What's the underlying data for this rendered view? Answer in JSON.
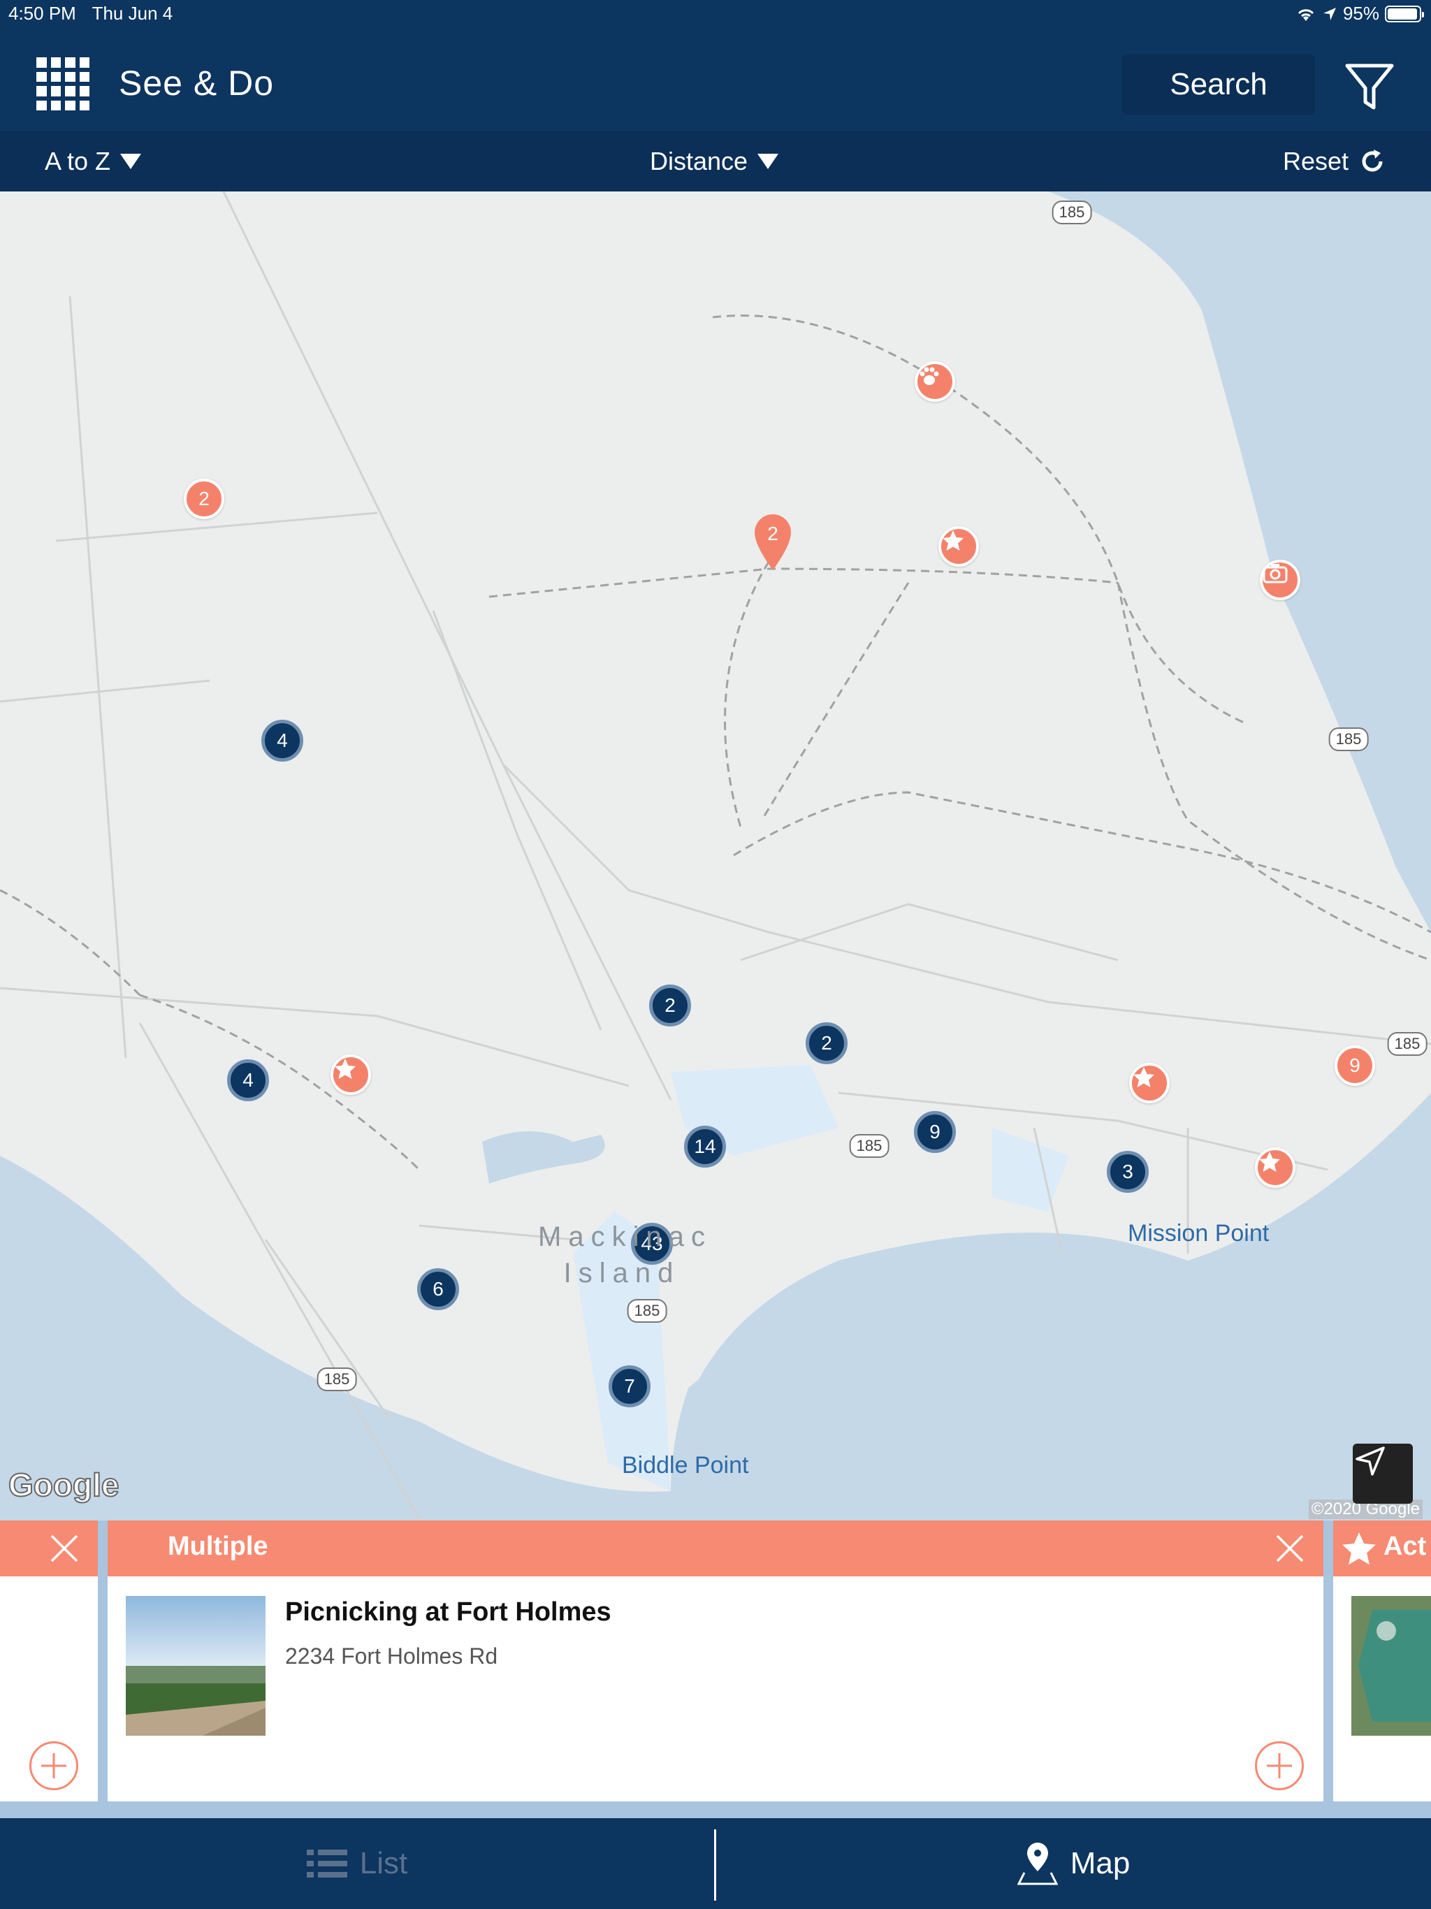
{
  "status_bar": {
    "time": "4:50 PM",
    "date": "Thu Jun 4",
    "battery_text": "95%",
    "battery_level": 0.95
  },
  "header": {
    "title": "See & Do",
    "search_label": "Search"
  },
  "sort_bar": {
    "sort_az": "A to Z",
    "sort_distance": "Distance",
    "reset": "Reset"
  },
  "map": {
    "clusters_navy": [
      "4",
      "4",
      "2",
      "2",
      "14",
      "9",
      "3",
      "43",
      "6",
      "7"
    ],
    "pins_orange": [
      "2",
      "2",
      "9"
    ],
    "labels": {
      "mission_point": "Mission Point",
      "biddle_point": "Biddle Point",
      "island_line1": "Mackinac",
      "island_line2": "Island"
    },
    "route": "185",
    "google": "Google",
    "copyright": "©2020 Google"
  },
  "cards": {
    "main": {
      "category": "Multiple",
      "title": "Picnicking at Fort Holmes",
      "address": "2234 Fort Holmes Rd"
    },
    "next_category": "Act"
  },
  "tab_bar": {
    "list_label": "List",
    "map_label": "Map"
  },
  "colors": {
    "navy": "#0c3560",
    "accent": "#f68a72",
    "water": "#c5d8e8"
  }
}
